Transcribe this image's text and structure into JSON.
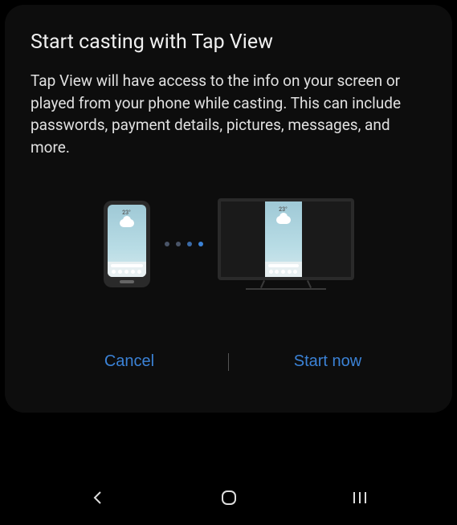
{
  "dialog": {
    "title": "Start casting with Tap View",
    "description": "Tap View will have access to the info on your screen or played from your phone while casting. This can include passwords, payment details, pictures, messages, and more.",
    "cancel_label": "Cancel",
    "start_label": "Start now"
  },
  "illustration": {
    "phone_temp": "23°",
    "tv_temp": "23°",
    "connection_dots": [
      {
        "color": "#4a5568"
      },
      {
        "color": "#4a5568"
      },
      {
        "color": "#3b6ba8"
      },
      {
        "color": "#3b82d6"
      }
    ]
  }
}
